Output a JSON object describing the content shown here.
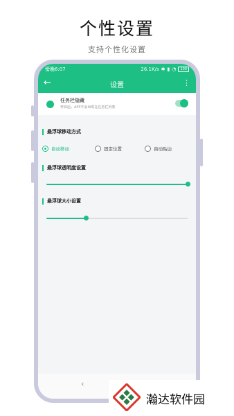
{
  "page": {
    "title": "个性设置",
    "subtitle": "支持个性化设置"
  },
  "status_bar": {
    "carrier_time": "傍晚6:07",
    "speed": "26.1K/s",
    "battery": "100"
  },
  "app_bar": {
    "title": "设置"
  },
  "taskbar_hide": {
    "title": "任务栏隐藏",
    "description": "开启后，APP不会出现在任务栏列表",
    "enabled": true
  },
  "move_mode": {
    "label": "悬浮球移动方式",
    "options": [
      {
        "label": "自动移动",
        "selected": true
      },
      {
        "label": "固定位置",
        "selected": false
      },
      {
        "label": "自动贴边",
        "selected": false
      }
    ]
  },
  "transparency": {
    "label": "悬浮球透明度设置",
    "value": 1.0
  },
  "size": {
    "label": "悬浮球大小设置",
    "value": 0.28
  },
  "nav": {
    "back_symbol": "‹"
  },
  "watermark": {
    "text": "瀚达软件园"
  },
  "colors": {
    "accent": "#1dbf84",
    "frame": "#c9cade"
  }
}
